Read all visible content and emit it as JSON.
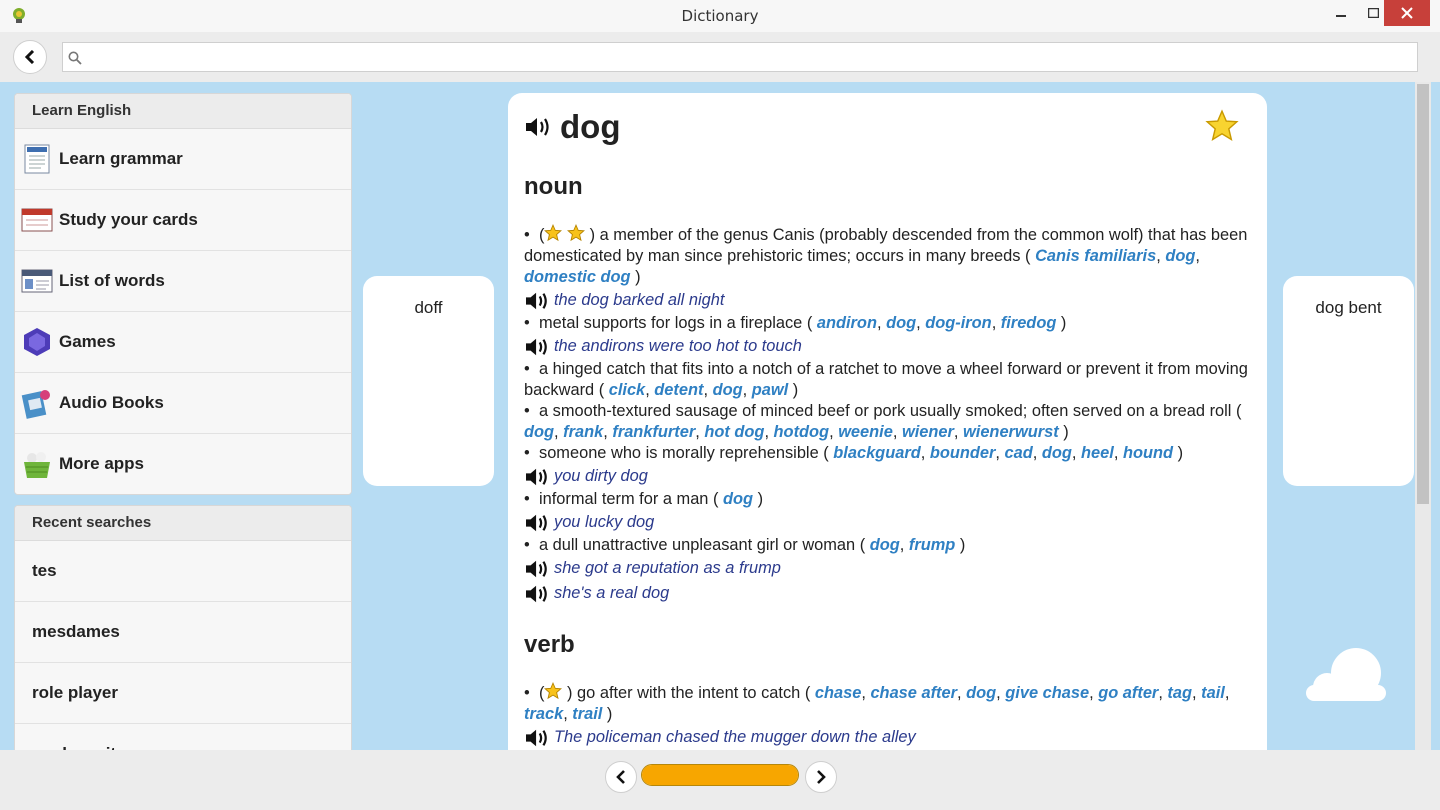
{
  "window": {
    "title": "Dictionary"
  },
  "search": {
    "value": "",
    "placeholder": ""
  },
  "sidebar": {
    "learn_heading": "Learn English",
    "items": [
      {
        "label": "Learn grammar",
        "icon": "grammar-book-icon"
      },
      {
        "label": "Study your cards",
        "icon": "flashcards-icon"
      },
      {
        "label": "List of words",
        "icon": "word-list-icon"
      },
      {
        "label": "Games",
        "icon": "games-gem-icon"
      },
      {
        "label": "Audio Books",
        "icon": "audio-books-icon"
      },
      {
        "label": "More apps",
        "icon": "more-apps-basket-icon"
      }
    ],
    "recent_heading": "Recent searches",
    "recent": [
      "tes",
      "mesdames",
      "role player",
      "quebec city"
    ]
  },
  "neighbors": {
    "previous": "doff",
    "next": "dog bent"
  },
  "entry": {
    "word": "dog",
    "noun_label": "noun",
    "verb_label": "verb",
    "noun_defs": [
      {
        "text": "a member of the genus Canis (probably descended from the common wolf) that has been domesticated by man since prehistoric times; occurs in many breeds",
        "stars": 2,
        "synonyms": [
          "Canis familiaris",
          "dog",
          "domestic dog"
        ],
        "examples": [
          "the dog barked all night"
        ]
      },
      {
        "text": "metal supports for logs in a fireplace",
        "stars": 0,
        "synonyms": [
          "andiron",
          "dog",
          "dog-iron",
          "firedog"
        ],
        "examples": [
          "the andirons were too hot to touch"
        ]
      },
      {
        "text": "a hinged catch that fits into a notch of a ratchet to move a wheel forward or prevent it from moving backward",
        "stars": 0,
        "synonyms": [
          "click",
          "detent",
          "dog",
          "pawl"
        ],
        "examples": []
      },
      {
        "text": "a smooth-textured sausage of minced beef or pork usually smoked; often served on a bread roll",
        "stars": 0,
        "synonyms": [
          "dog",
          "frank",
          "frankfurter",
          "hot dog",
          "hotdog",
          "weenie",
          "wiener",
          "wienerwurst"
        ],
        "examples": []
      },
      {
        "text": "someone who is morally reprehensible",
        "stars": 0,
        "synonyms": [
          "blackguard",
          "bounder",
          "cad",
          "dog",
          "heel",
          "hound"
        ],
        "examples": [
          "you dirty dog"
        ]
      },
      {
        "text": "informal term for a man",
        "stars": 0,
        "synonyms": [
          "dog"
        ],
        "examples": [
          "you lucky dog"
        ]
      },
      {
        "text": "a dull unattractive unpleasant girl or woman",
        "stars": 0,
        "synonyms": [
          "dog",
          "frump"
        ],
        "examples": [
          "she got a reputation as a frump",
          "she's a real dog"
        ]
      }
    ],
    "verb_defs": [
      {
        "text": "go after with the intent to catch",
        "stars": 1,
        "synonyms": [
          "chase",
          "chase after",
          "dog",
          "give chase",
          "go after",
          "tag",
          "tail",
          "track",
          "trail"
        ],
        "examples": [
          "The policeman chased the mugger down the alley"
        ]
      }
    ]
  },
  "progress": {
    "fraction": 1.0
  },
  "colors": {
    "accent": "#f7a600",
    "link": "#2f80c3",
    "example": "#2b3a8c",
    "background": "#b7dcf3"
  }
}
